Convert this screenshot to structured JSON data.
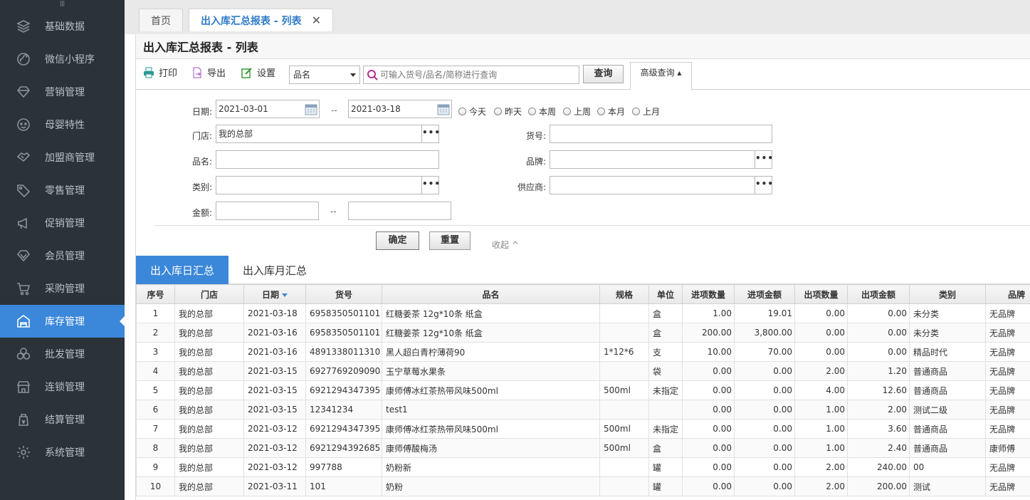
{
  "sidebar": {
    "grip": "Ⅲ",
    "items": [
      {
        "label": "基础数据",
        "icon": "layers-icon"
      },
      {
        "label": "微信小程序",
        "icon": "wechat-miniprogram-icon"
      },
      {
        "label": "营销管理",
        "icon": "diamond-icon"
      },
      {
        "label": "母婴特性",
        "icon": "baby-face-icon"
      },
      {
        "label": "加盟商管理",
        "icon": "handshake-icon"
      },
      {
        "label": "零售管理",
        "icon": "price-tag-icon"
      },
      {
        "label": "促销管理",
        "icon": "megaphone-icon"
      },
      {
        "label": "会员管理",
        "icon": "member-diamond-icon"
      },
      {
        "label": "采购管理",
        "icon": "cart-icon"
      },
      {
        "label": "库存管理",
        "icon": "warehouse-icon"
      },
      {
        "label": "批发管理",
        "icon": "boxes-icon"
      },
      {
        "label": "连锁管理",
        "icon": "store-icon"
      },
      {
        "label": "结算管理",
        "icon": "settlement-icon"
      },
      {
        "label": "系统管理",
        "icon": "gear-icon"
      }
    ],
    "active_index": 9
  },
  "tabs": {
    "home": "首页",
    "current": "出入库汇总报表 - 列表",
    "close": "✕"
  },
  "page_title": "出入库汇总报表 - 列表",
  "toolbar": {
    "print": "打印",
    "export": "导出",
    "settings": "设置",
    "field_select": "品名",
    "search_placeholder": "可输入货号/品名/简称进行查询",
    "query": "查询",
    "advanced": "高级查询 ▴"
  },
  "filter": {
    "date_label": "日期:",
    "date_from": "2021-03-01",
    "date_sep": "--",
    "date_to": "2021-03-18",
    "quick_dates": [
      "今天",
      "昨天",
      "本周",
      "上周",
      "本月",
      "上月"
    ],
    "store_label": "门店:",
    "store_value": "我的总部",
    "sku_label": "货号:",
    "name_label": "品名:",
    "brand_label": "品牌:",
    "category_label": "类别:",
    "supplier_label": "供应商:",
    "amount_label": "金额:",
    "amount_sep": "--",
    "dots": "•••",
    "confirm": "确定",
    "reset": "重置",
    "collapse": "收起 ^"
  },
  "summary_tabs": [
    "出入库日汇总",
    "出入库月汇总"
  ],
  "table": {
    "headers": [
      "序号",
      "门店",
      "日期",
      "货号",
      "品名",
      "规格",
      "单位",
      "进项数量",
      "进项金额",
      "出项数量",
      "出项金额",
      "类别",
      "品牌"
    ],
    "rows": [
      [
        "1",
        "我的总部",
        "2021-03-18",
        "6958350501101",
        "红糖姜茶 12g*10条 纸盒",
        "",
        "盒",
        "1.00",
        "19.01",
        "0.00",
        "0.00",
        "未分类",
        "无品牌"
      ],
      [
        "2",
        "我的总部",
        "2021-03-16",
        "6958350501101",
        "红糖姜茶 12g*10条 纸盒",
        "",
        "盒",
        "200.00",
        "3,800.00",
        "0.00",
        "0.00",
        "未分类",
        "无品牌"
      ],
      [
        "3",
        "我的总部",
        "2021-03-16",
        "4891338011310",
        "黑人超白青柠薄荷90",
        "1*12*6",
        "支",
        "10.00",
        "70.00",
        "0.00",
        "0.00",
        "精品时代",
        "无品牌"
      ],
      [
        "4",
        "我的总部",
        "2021-03-15",
        "6927769209090",
        "玉宁草莓水果条",
        "",
        "袋",
        "0.00",
        "0.00",
        "2.00",
        "1.20",
        "普通商品",
        "无品牌"
      ],
      [
        "5",
        "我的总部",
        "2021-03-15",
        "6921294347395",
        "康师傅冰红茶热带风味500ml",
        "500ml",
        "未指定",
        "0.00",
        "0.00",
        "4.00",
        "12.60",
        "普通商品",
        "无品牌"
      ],
      [
        "6",
        "我的总部",
        "2021-03-15",
        "12341234",
        "test1",
        "",
        "",
        "0.00",
        "0.00",
        "1.00",
        "2.00",
        "测试二级",
        "无品牌"
      ],
      [
        "7",
        "我的总部",
        "2021-03-12",
        "6921294347395",
        "康师傅冰红茶热带风味500ml",
        "500ml",
        "未指定",
        "0.00",
        "0.00",
        "1.00",
        "3.60",
        "普通商品",
        "无品牌"
      ],
      [
        "8",
        "我的总部",
        "2021-03-12",
        "6921294392685",
        "康师傅酸梅汤",
        "500ml",
        "盒",
        "0.00",
        "0.00",
        "1.00",
        "2.40",
        "普通商品",
        "康师傅"
      ],
      [
        "9",
        "我的总部",
        "2021-03-12",
        "997788",
        "奶粉新",
        "",
        "罐",
        "0.00",
        "0.00",
        "2.00",
        "240.00",
        "00",
        "无品牌"
      ],
      [
        "10",
        "我的总部",
        "2021-03-11",
        "101",
        "奶粉",
        "",
        "罐",
        "0.00",
        "0.00",
        "2.00",
        "200.00",
        "测试",
        "无品牌"
      ]
    ]
  },
  "colors": {
    "sidebar_bg": "#2b3238",
    "accent": "#3b87d9"
  }
}
